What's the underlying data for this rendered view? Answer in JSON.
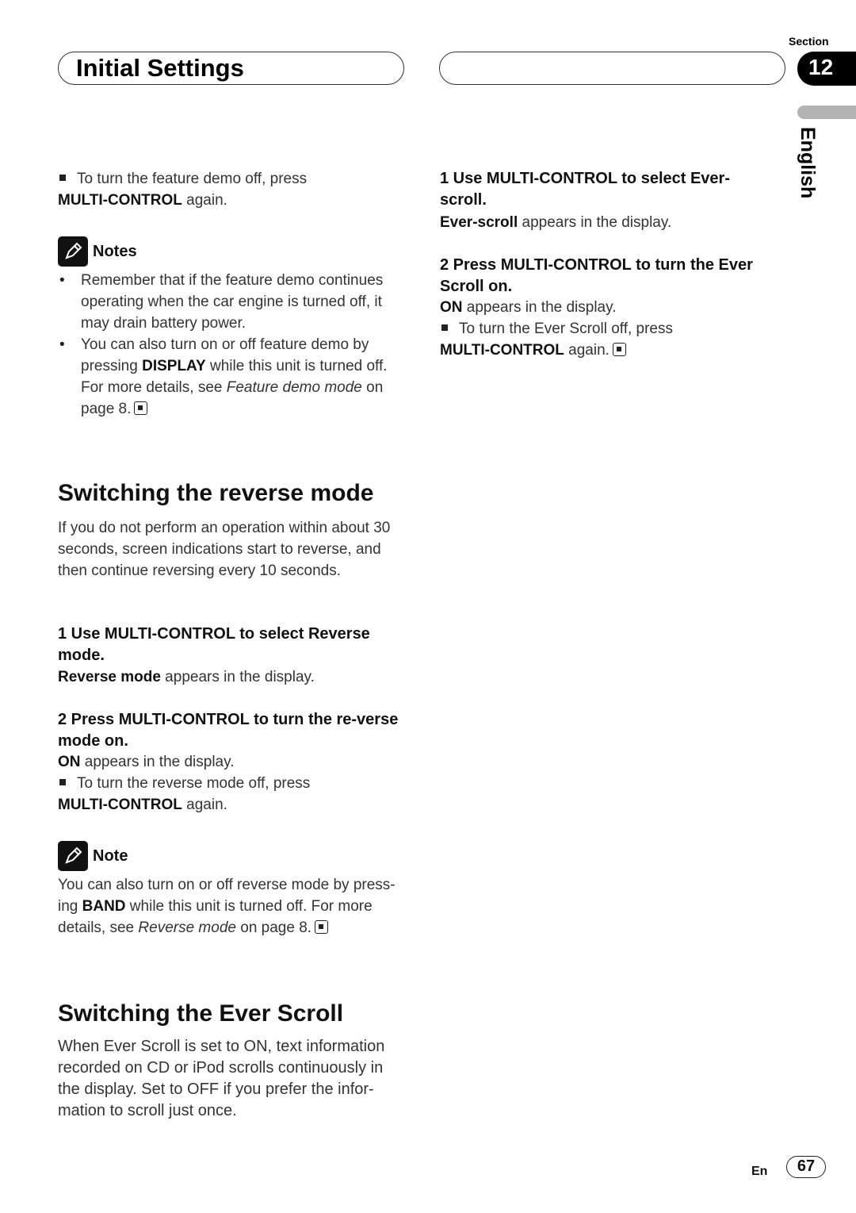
{
  "header": {
    "title": "Initial Settings",
    "right_title": "",
    "section_label": "Section",
    "section_number": "12",
    "language_tab": "English"
  },
  "left": {
    "demo_off": {
      "text": "To turn the feature demo off, press",
      "bold": "MULTI-CONTROL",
      "suffix": " again."
    },
    "notes": {
      "heading": "Notes",
      "items": [
        {
          "text": "Remember that if the feature demo continues operating when the car engine is turned off, it may drain battery power."
        },
        {
          "pre": "You can also turn on or off feature demo by pressing ",
          "bold": "DISPLAY",
          "mid": " while this unit is turned off. For more details, see ",
          "italic": "Feature demo mode",
          "post": " on page 8."
        }
      ]
    },
    "reverse": {
      "heading": "Switching the reverse mode",
      "intro": "If you do not perform an operation within about 30 seconds, screen indications start to reverse, and then continue reversing every 10 seconds.",
      "step1_title": "1    Use MULTI-CONTROL to select Reverse mode.",
      "step1_bold": "Reverse mode",
      "step1_text": " appears in the display.",
      "step2_title": "2    Press MULTI-CONTROL to turn the re-verse mode on.",
      "step2_bold": "ON",
      "step2_text": " appears in the display.",
      "off_text": "To turn the reverse mode off, press",
      "off_bold": "MULTI-CONTROL",
      "off_suffix": " again.",
      "note_heading": "Note",
      "note_pre": "You can also turn on or off reverse mode by press-ing ",
      "note_bold": "BAND",
      "note_mid": " while this unit is turned off. For more details, see ",
      "note_italic": "Reverse mode",
      "note_post": " on page 8."
    },
    "ever": {
      "heading": "Switching the Ever Scroll",
      "intro": "When Ever Scroll is set to ON, text information recorded on CD or iPod scrolls continuously in the display. Set to OFF if you prefer the infor-mation to scroll just once."
    }
  },
  "right": {
    "step1_title": "1    Use MULTI-CONTROL to select Ever-scroll.",
    "step1_bold": "Ever-scroll",
    "step1_text": " appears in the display.",
    "step2_title": "2    Press MULTI-CONTROL to turn the Ever Scroll on.",
    "step2_bold": "ON",
    "step2_text": " appears in the display.",
    "off_text": "To turn the Ever Scroll off, press",
    "off_bold": "MULTI-CONTROL",
    "off_suffix": " again."
  },
  "footer": {
    "lang": "En",
    "page": "67"
  }
}
